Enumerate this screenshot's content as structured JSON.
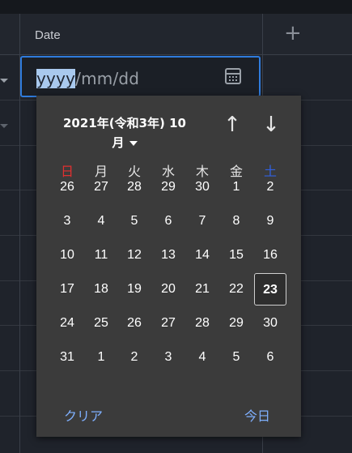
{
  "grid": {
    "date_header": "Date",
    "add_column_icon": "plus-icon",
    "plus_glyph": "+"
  },
  "date_input": {
    "segment_year": "yyyy",
    "segment_rest": "/mm/dd",
    "calendar_icon": "calendar-icon"
  },
  "calendar": {
    "month_line1": "2021年(令和3年) 10",
    "month_line2": "月",
    "nav_up_glyph": "↑",
    "nav_down_glyph": "↓",
    "weekdays": [
      "日",
      "月",
      "火",
      "水",
      "木",
      "金",
      "土"
    ],
    "weekday_colors": [
      "#e03030",
      "#e6e6e6",
      "#e6e6e6",
      "#e6e6e6",
      "#e6e6e6",
      "#e6e6e6",
      "#3060e0"
    ],
    "weeks": [
      [
        "26",
        "27",
        "28",
        "29",
        "30",
        "1",
        "2"
      ],
      [
        "3",
        "4",
        "5",
        "6",
        "7",
        "8",
        "9"
      ],
      [
        "10",
        "11",
        "12",
        "13",
        "14",
        "15",
        "16"
      ],
      [
        "17",
        "18",
        "19",
        "20",
        "21",
        "22",
        "23"
      ],
      [
        "24",
        "25",
        "26",
        "27",
        "28",
        "29",
        "30"
      ],
      [
        "31",
        "1",
        "2",
        "3",
        "4",
        "5",
        "6"
      ]
    ],
    "today_value": "23",
    "clear_label": "クリア",
    "today_label": "今日"
  },
  "colors": {
    "accent": "#2f7bdc",
    "link": "#7fb0ff",
    "sunday": "#e03030",
    "saturday": "#3060e0"
  }
}
